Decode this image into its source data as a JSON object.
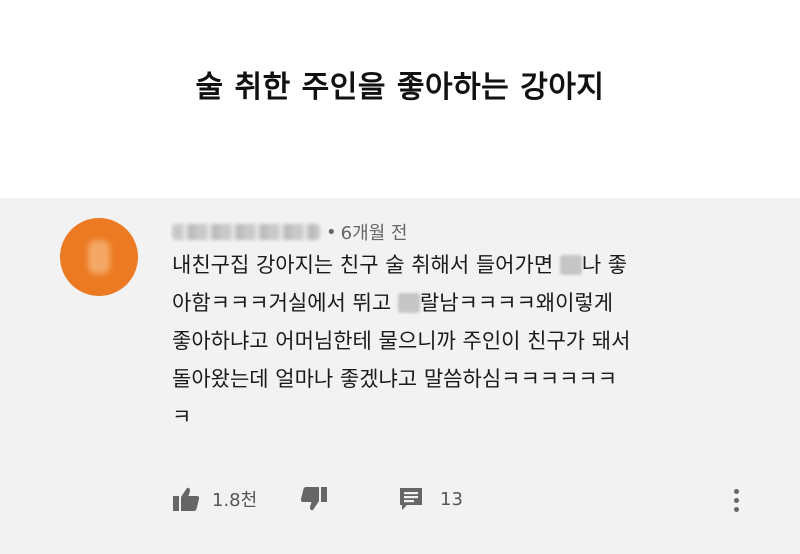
{
  "headline": "술 취한 주인을 좋아하는 강아지",
  "comment": {
    "time_ago": "6개월 전",
    "separator": "•",
    "line1_a": "내친구집 강아지는 친구 술 취해서 들어가면 ",
    "line1_b": "나 좋",
    "line2_a": "아함ㅋㅋㅋ거실에서 뛰고 ",
    "line2_b": "랄남ㅋㅋㅋㅋ왜이렇게",
    "line3": "좋아하냐고 어머님한테 물으니까 주인이 친구가 돼서",
    "line4": "돌아왔는데 얼마나 좋겠냐고 말씀하심ㅋㅋㅋㅋㅋㅋ",
    "line5": "ㅋ",
    "likes": "1.8천",
    "replies": "13",
    "accent_color": "#ec7a22"
  }
}
